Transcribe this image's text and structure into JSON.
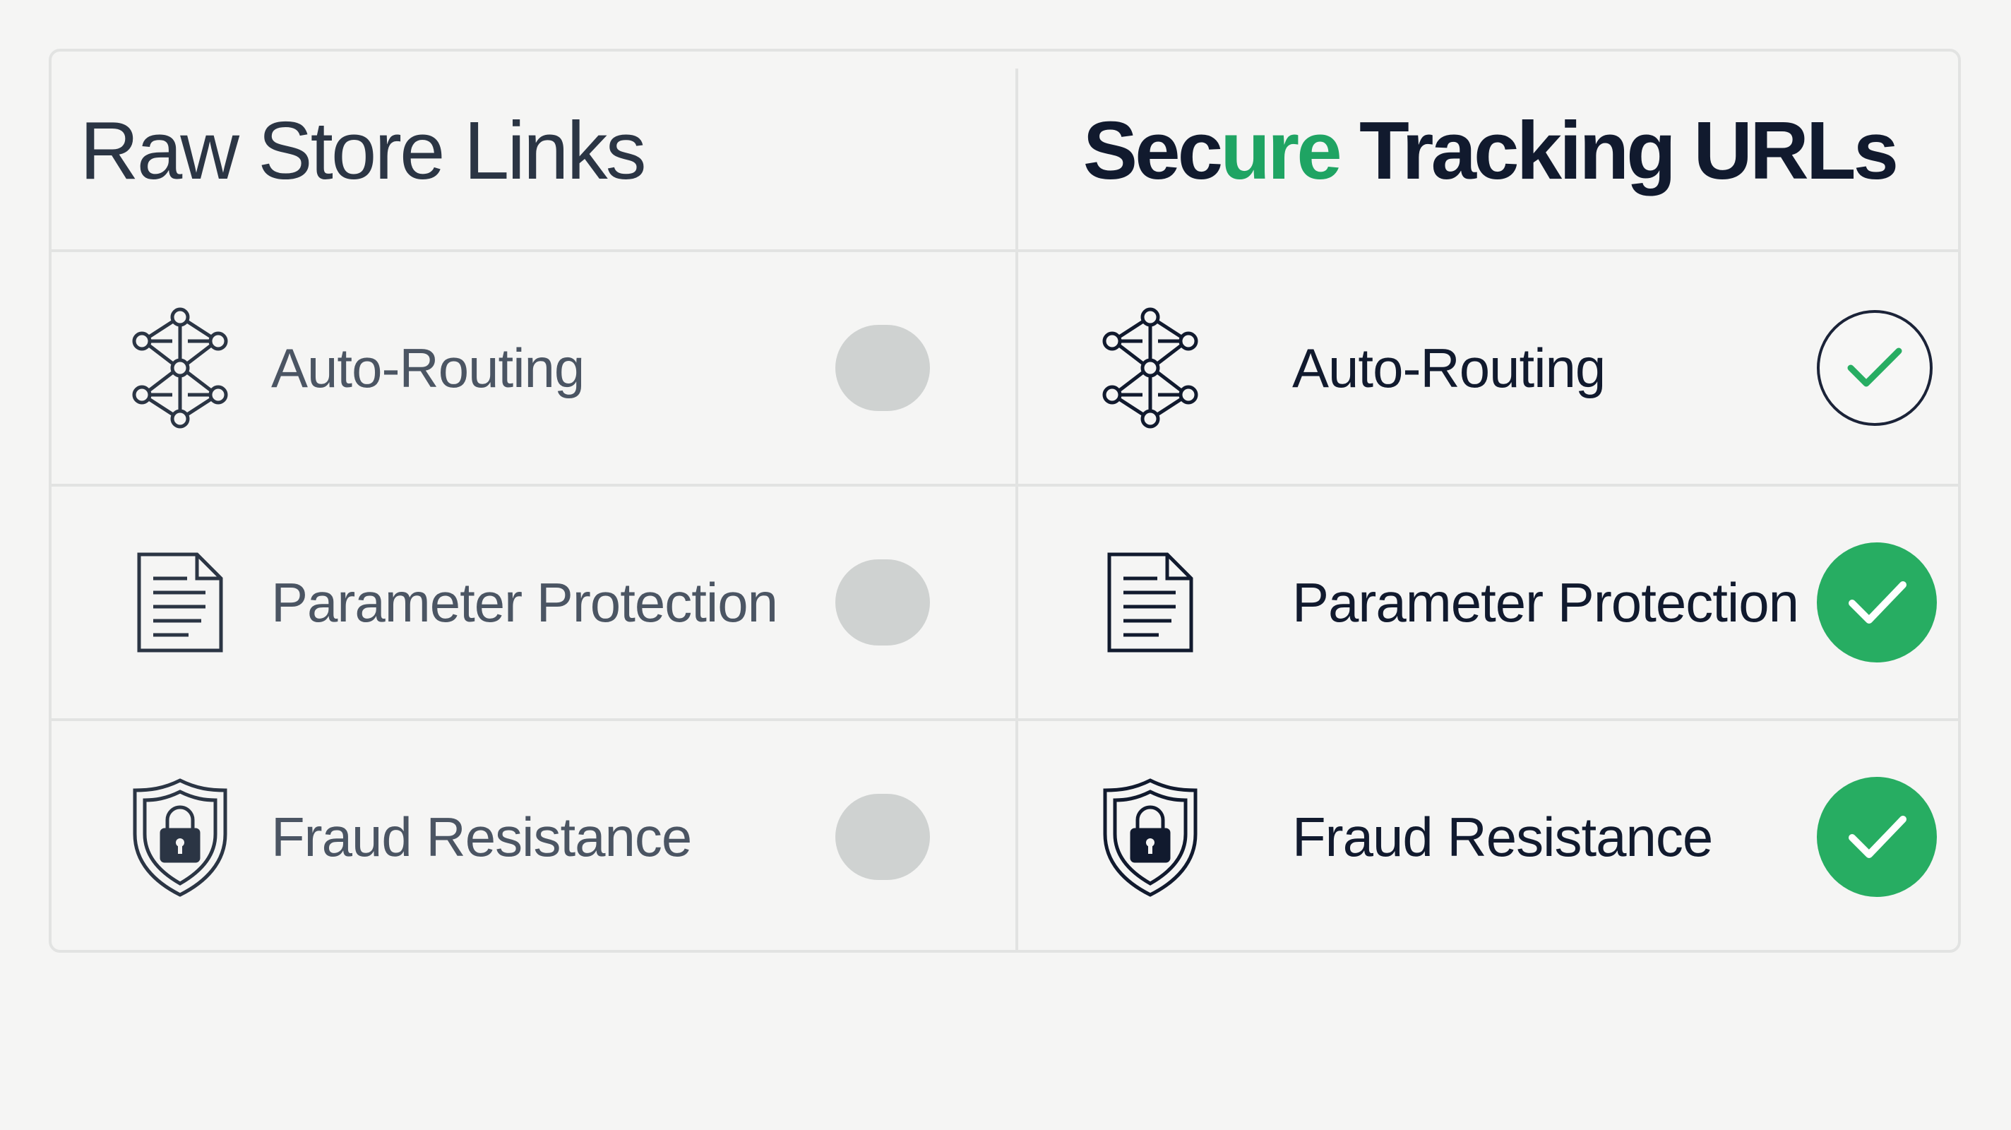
{
  "left_column": {
    "title": "Raw Store Links",
    "rows": [
      {
        "label": "Auto-Routing",
        "icon": "network-icon",
        "status": "unavailable"
      },
      {
        "label": "Parameter Protection",
        "icon": "document-icon",
        "status": "unavailable"
      },
      {
        "label": "Fraud Resistance",
        "icon": "shield-lock-icon",
        "status": "unavailable"
      }
    ]
  },
  "right_column": {
    "title_part1": "Sec",
    "title_accent": "ure",
    "title_part2": " Tracking URLs",
    "rows": [
      {
        "label": "Auto-Routing",
        "icon": "network-icon",
        "status": "check-outline"
      },
      {
        "label": "Parameter Protection",
        "icon": "document-icon",
        "status": "check-filled"
      },
      {
        "label": "Fraud Resistance",
        "icon": "shield-lock-icon",
        "status": "check-filled"
      }
    ]
  },
  "colors": {
    "accent_green": "#1fa463",
    "check_green": "#27ad62",
    "navy": "#111a2e",
    "muted_gray": "#cfd2d1"
  }
}
